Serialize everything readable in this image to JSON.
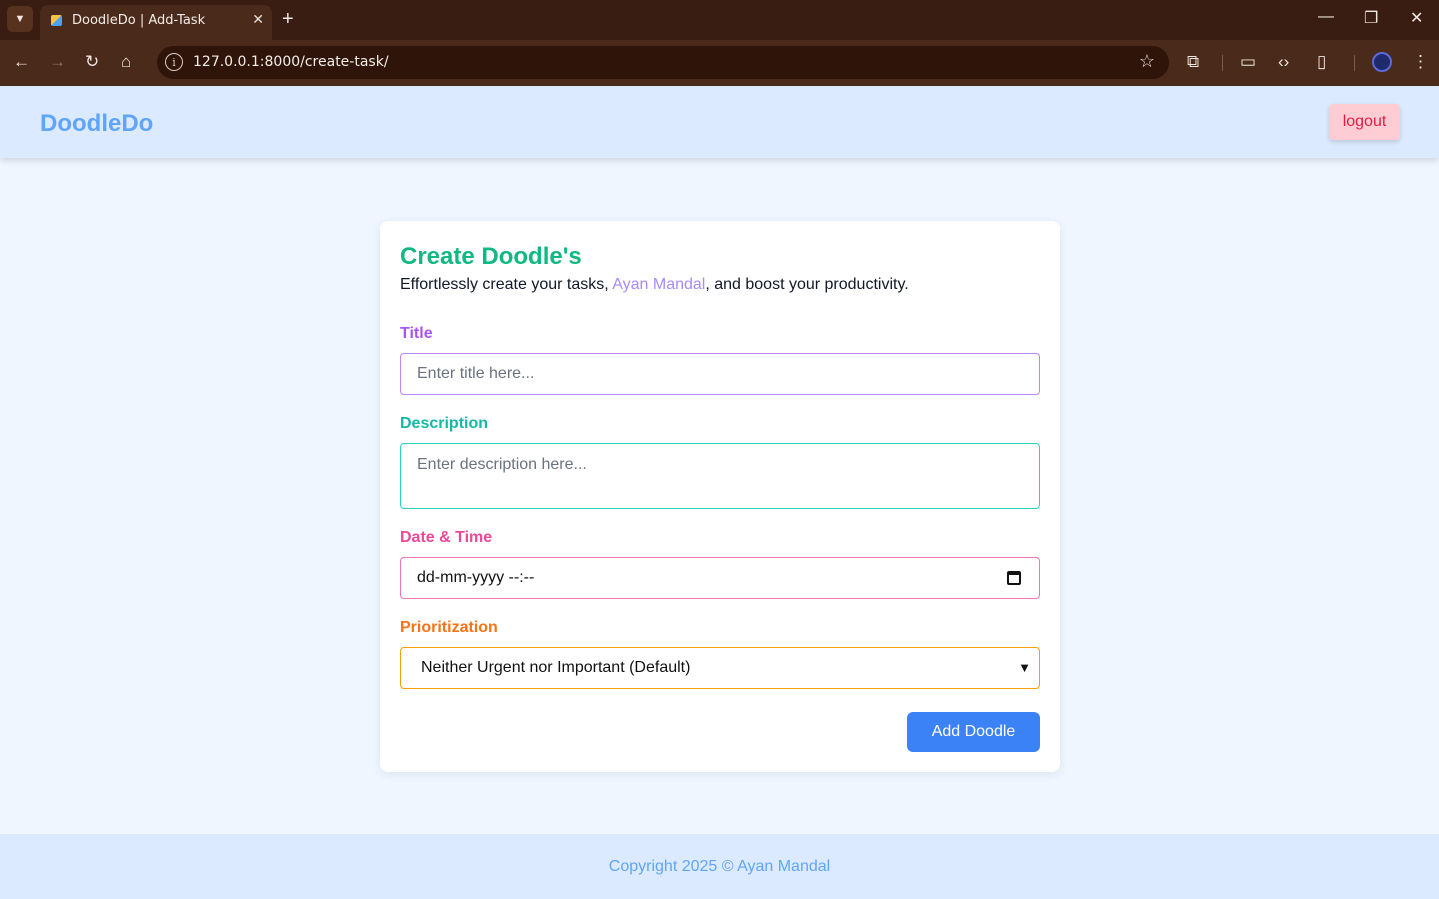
{
  "browser": {
    "tab_title": "DoodleDo | Add-Task",
    "url": "127.0.0.1:8000/create-task/",
    "tab_close": "✕",
    "new_tab": "+"
  },
  "header": {
    "brand": "DoodleDo",
    "logout_label": "logout"
  },
  "form": {
    "heading": "Create Doodle's",
    "subtitle_prefix": "Effortlessly create your tasks, ",
    "subtitle_name": "Ayan Mandal",
    "subtitle_suffix": ", and boost your productivity.",
    "title_label": "Title",
    "title_placeholder": "Enter title here...",
    "description_label": "Description",
    "description_placeholder": "Enter description here...",
    "datetime_label": "Date & Time",
    "datetime_value": "dd-mm-yyyy --:--",
    "priority_label": "Prioritization",
    "priority_selected": "Neither Urgent nor Important (Default)",
    "submit_label": "Add Doodle"
  },
  "footer": {
    "copyright": "Copyright 2025 © Ayan Mandal"
  },
  "colors": {
    "brand": "#60a5fa",
    "heading": "#10b981",
    "title_label": "#a855f7",
    "description_label": "#14b8a6",
    "datetime_label": "#ec4899",
    "priority_label": "#f97316",
    "submit_bg": "#3b82f6",
    "logout_bg": "#fecdd3"
  }
}
